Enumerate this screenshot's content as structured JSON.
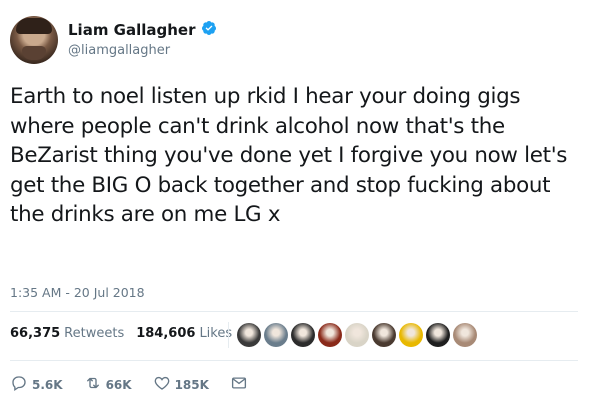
{
  "user": {
    "name": "Liam Gallagher",
    "handle": "@liamgallagher",
    "verified_icon": "verified-badge-icon"
  },
  "tweet": {
    "text": "Earth to noel listen up rkid I hear your doing gigs where people can't drink alcohol now that's the BeZarist thing you've done yet I forgive you now let's get the BIG O back together and stop fucking about the drinks are on me LG x",
    "timestamp": "1:35 AM - 20 Jul 2018"
  },
  "stats": {
    "retweets_count": "66,375",
    "retweets_label": "Retweets",
    "likes_count": "184,606",
    "likes_label": "Likes"
  },
  "likers": [
    {
      "color": "#3a3a3a"
    },
    {
      "color": "#6a7d8c"
    },
    {
      "color": "#2c2c2c"
    },
    {
      "color": "#8a2a1a"
    },
    {
      "color": "#d9d4c7"
    },
    {
      "color": "#4a3a30"
    },
    {
      "color": "#e8b800"
    },
    {
      "color": "#1f1f1f"
    },
    {
      "color": "#a88a76"
    }
  ],
  "actions": {
    "replies": "5.6K",
    "retweets": "66K",
    "likes": "185K"
  },
  "colors": {
    "accent": "#1da1f2",
    "muted": "#657786",
    "text": "#14171a"
  }
}
